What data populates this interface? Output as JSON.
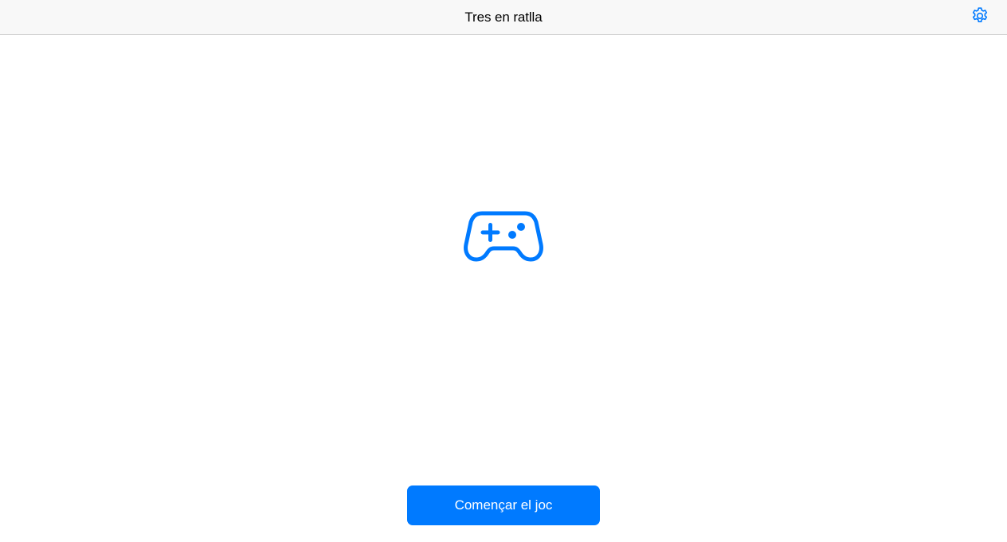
{
  "navbar": {
    "title": "Tres en ratlla",
    "settings_icon": "gear-icon"
  },
  "main": {
    "hero_icon": "game-controller-icon",
    "start_button_label": "Començar el joc"
  },
  "colors": {
    "accent": "#007aff",
    "navbar_background": "#f8f8f8",
    "background": "#ffffff",
    "title_text": "#000000",
    "button_text": "#ffffff"
  }
}
